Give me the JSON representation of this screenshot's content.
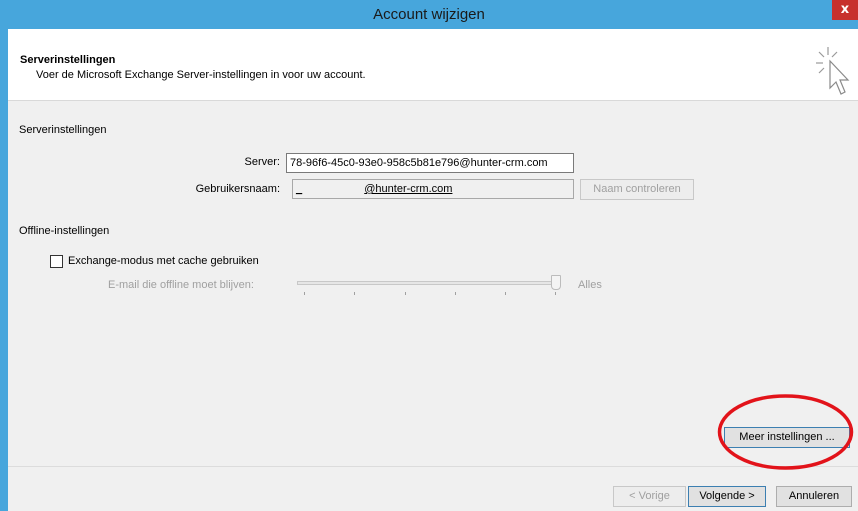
{
  "window": {
    "title": "Account wijzigen",
    "close_glyph": "x"
  },
  "header": {
    "title": "Serverinstellingen",
    "subtitle": "Voer de Microsoft Exchange Server-instellingen in voor uw account.",
    "icon": "cursor-sparkle-icon"
  },
  "server_settings": {
    "section_label": "Serverinstellingen",
    "server_label": "Server:",
    "server_value": "78-96f6-45c0-93e0-958c5b81e796@hunter-crm.com",
    "username_label": "Gebruikersnaam:",
    "username_prefix": "_",
    "username_value": "@hunter-crm.com",
    "check_name_button": "Naam controleren"
  },
  "offline_settings": {
    "section_label": "Offline-instellingen",
    "cache_checkbox_label": "Exchange-modus met cache gebruiken",
    "cache_checked": false,
    "slider_label": "E-mail die offline moet blijven:",
    "slider_value_label": "Alles",
    "slider_position": 1.0
  },
  "buttons": {
    "more_settings": "Meer instellingen ...",
    "previous": "< Vorige",
    "next": "Volgende >",
    "cancel": "Annuleren"
  },
  "colors": {
    "titlebar": "#47a6dc",
    "close": "#c7302d",
    "annotation": "#e2131a"
  }
}
